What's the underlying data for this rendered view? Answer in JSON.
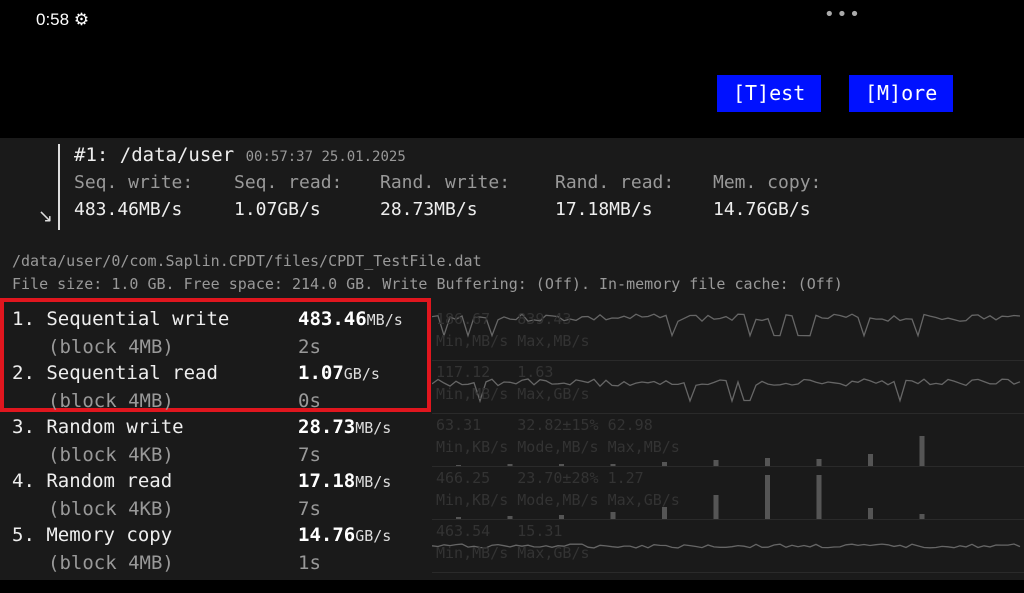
{
  "status": {
    "time": "0:58",
    "icon": "gear-icon",
    "menu_icon": "more-dots-icon"
  },
  "buttons": {
    "test": "[T]est",
    "more": "[M]ore"
  },
  "history": {
    "title": "#1: /data/user",
    "timestamp": "00:57:37 25.01.2025",
    "arrow_icon": "arrow-down-right-icon",
    "labels": [
      "Seq. write:",
      "Seq. read:",
      "Rand. write:",
      "Rand. read:",
      "Mem. copy:"
    ],
    "values": [
      "483.46MB/s",
      "1.07GB/s",
      "28.73MB/s",
      "17.18MB/s",
      "14.76GB/s"
    ]
  },
  "file_path": "/data/user/0/com.Saplin.CPDT/files/CPDT_TestFile.dat",
  "file_info": "File size: 1.0 GB. Free space: 214.0 GB. Write Buffering: (Off). In-memory file cache: (Off)",
  "results": [
    {
      "name": "1. Sequential write",
      "block": "(block 4MB)",
      "value": "483.46",
      "unit": "MB/s",
      "time": "2s",
      "graph": "line",
      "stats": "186.67   839.43",
      "stats_labels": "Min,MB/s Max,MB/s"
    },
    {
      "name": "2. Sequential read",
      "block": "(block 4MB)",
      "value": "1.07",
      "unit": "GB/s",
      "time": "0s",
      "graph": "line",
      "stats": "117.12   1.63",
      "stats_labels": "Min,MB/s Max,GB/s"
    },
    {
      "name": "3. Random write",
      "block": "(block 4KB)",
      "value": "28.73",
      "unit": "MB/s",
      "time": "7s",
      "graph": "bars",
      "stats": "63.31    32.82±15% 62.98",
      "stats_labels": "Min,KB/s Mode,MB/s Max,MB/s"
    },
    {
      "name": "4. Random read",
      "block": "(block 4KB)",
      "value": "17.18",
      "unit": "MB/s",
      "time": "7s",
      "graph": "bars",
      "stats": "466.25   23.70±28% 1.27",
      "stats_labels": "Min,KB/s Mode,MB/s Max,GB/s"
    },
    {
      "name": "5. Memory copy",
      "block": "(block 4MB)",
      "value": "14.76",
      "unit": "GB/s",
      "time": "1s",
      "graph": "line",
      "stats": "463.54   15.31",
      "stats_labels": "Min,MB/s Max,GB/s"
    }
  ],
  "highlight_color": "#e0161e",
  "accent": "#0011ff"
}
